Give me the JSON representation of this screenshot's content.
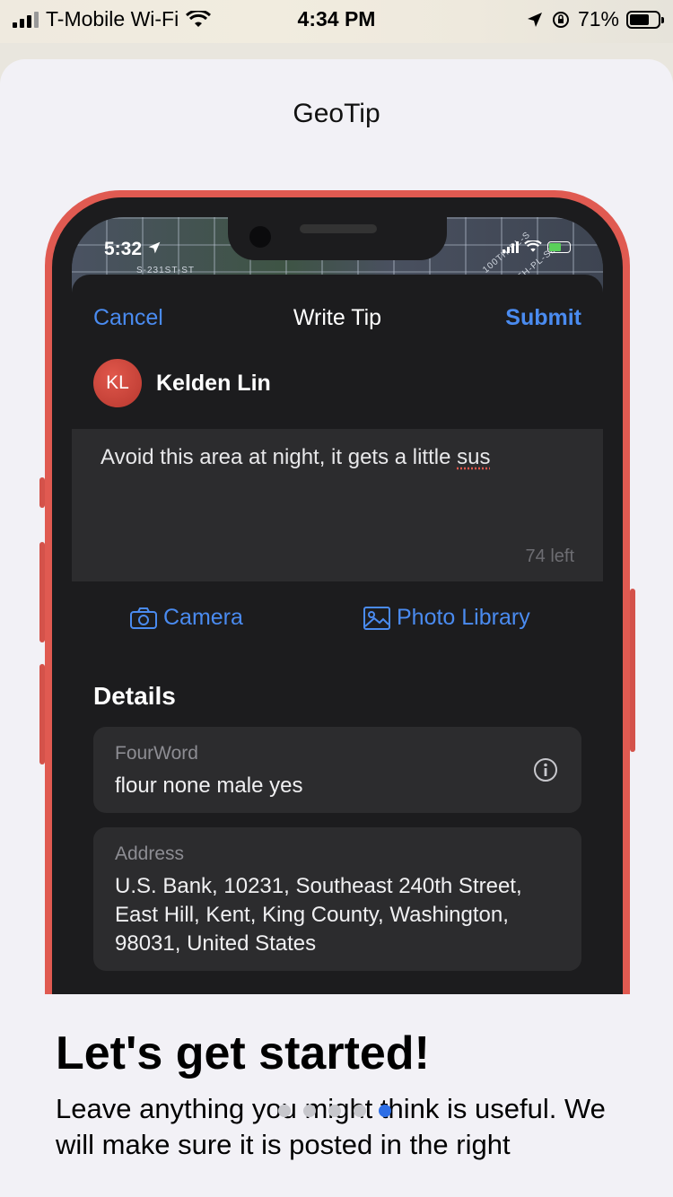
{
  "status_bar": {
    "carrier": "T-Mobile Wi-Fi",
    "time": "4:34 PM",
    "battery": "71%",
    "battery_level": 0.71
  },
  "sheet": {
    "title": "GeoTip"
  },
  "mockup": {
    "status_time": "5:32",
    "map_labels": [
      "S-231ST-ST",
      "100TH-PL-S",
      "TH-PL-SE"
    ],
    "nav": {
      "cancel": "Cancel",
      "title": "Write Tip",
      "submit": "Submit"
    },
    "user": {
      "initials": "KL",
      "name": "Kelden Lin"
    },
    "tip": {
      "text_main": "Avoid this area at night, it gets a little ",
      "text_flagged": "sus",
      "chars_left": "74 left"
    },
    "media": {
      "camera": "Camera",
      "photo_library": "Photo Library"
    },
    "details": {
      "heading": "Details",
      "fourword_label": "FourWord",
      "fourword_value": "flour none male yes",
      "address_label": "Address",
      "address_value": "U.S. Bank, 10231, Southeast 240th Street, East Hill, Kent, King County, Washington, 98031, United States"
    }
  },
  "onboarding": {
    "title": "Let's get started!",
    "body": "Leave anything you might think is useful. We will make sure it is posted in the right",
    "page_count": 5,
    "active_page": 5
  },
  "colors": {
    "accent": "#4a8bf0",
    "phone_frame": "#e05a51",
    "active_dot": "#2d6ee6"
  }
}
